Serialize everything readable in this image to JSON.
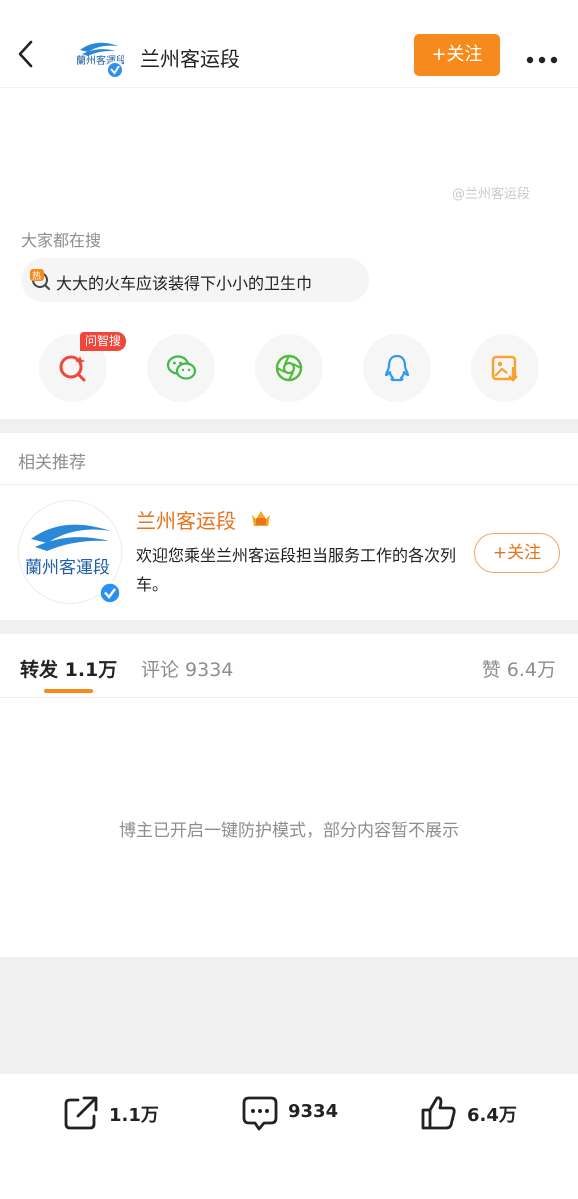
{
  "header": {
    "title": "兰州客运段",
    "follow_label": "+关注"
  },
  "watermark": "@兰州客运段",
  "search": {
    "hint": "大家都在搜",
    "hot_badge": "热",
    "hot_query": "大大的火车应该装得下小小的卫生巾"
  },
  "share": {
    "wenzhisou_badge": "问智搜",
    "icons": [
      "wenzhisou-search-icon",
      "wechat-icon",
      "moments-icon",
      "qq-icon",
      "save-image-icon"
    ]
  },
  "related": {
    "section_title": "相关推荐",
    "name": "兰州客运段",
    "avatar_text": "蘭州客運段",
    "description": "欢迎您乘坐兰州客运段担当服务工作的各次列车。",
    "follow_label": "+关注"
  },
  "tabs": {
    "forward": "转发 1.1万",
    "comment": "评论 9334",
    "like": "赞 6.4万"
  },
  "notice": "博主已开启一键防护模式，部分内容暂不展示",
  "bottom_bar": {
    "forward_count": "1.1万",
    "comment_count": "9334",
    "like_count": "6.4万"
  },
  "colors": {
    "accent": "#f78a1d",
    "name_orange": "#e8731c",
    "verified_blue": "#2d8ff0",
    "badge_red": "#f0473c"
  }
}
